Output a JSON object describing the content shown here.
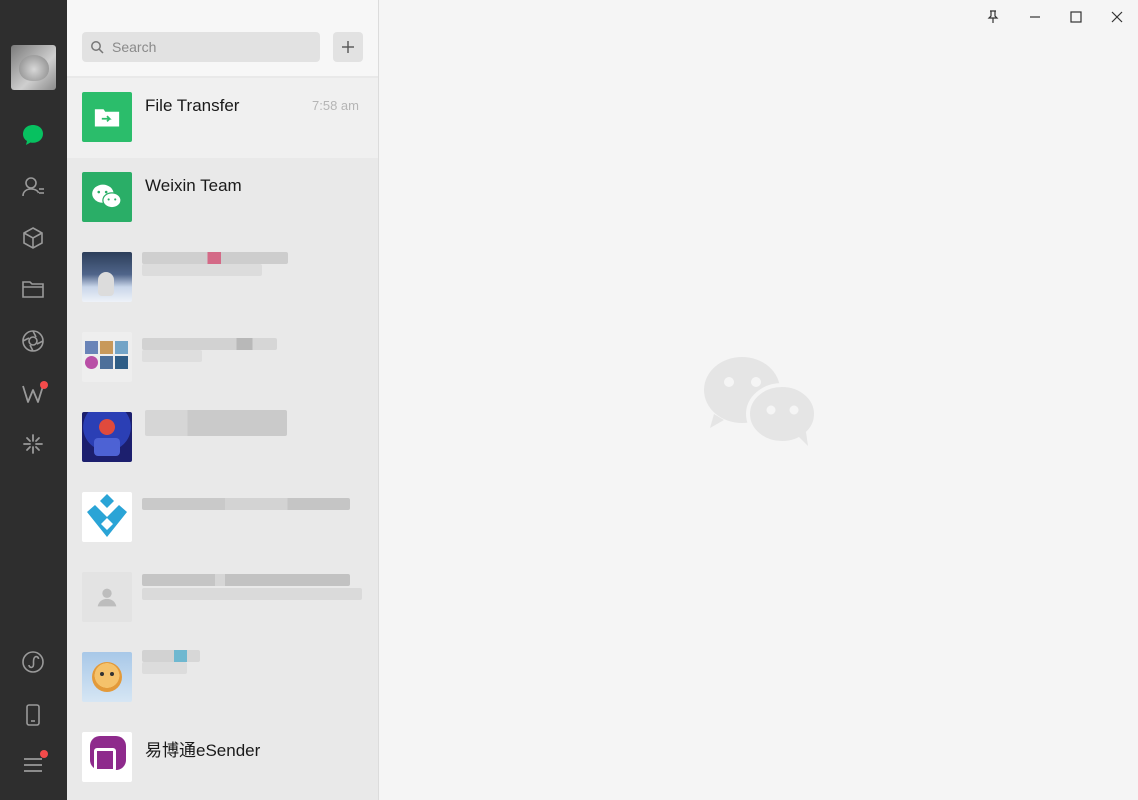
{
  "sidebar": {
    "nav": [
      {
        "id": "chats",
        "icon": "chat-bubble-icon",
        "active": true
      },
      {
        "id": "contacts",
        "icon": "contacts-icon"
      },
      {
        "id": "favorites",
        "icon": "cube-icon"
      },
      {
        "id": "files",
        "icon": "folder-icon"
      },
      {
        "id": "moments",
        "icon": "aperture-icon"
      },
      {
        "id": "channels",
        "icon": "channels-icon",
        "badge": true
      },
      {
        "id": "search",
        "icon": "sparkle-icon"
      }
    ],
    "bottom": [
      {
        "id": "mini-programs",
        "icon": "mini-program-icon"
      },
      {
        "id": "phone",
        "icon": "phone-icon"
      },
      {
        "id": "menu",
        "icon": "menu-icon",
        "badge": true
      }
    ],
    "accent_color": "#07c160"
  },
  "search": {
    "placeholder": "Search"
  },
  "chats": [
    {
      "name": "File Transfer",
      "time": "7:58 am",
      "thumb": "file-transfer"
    },
    {
      "name": "Weixin Team",
      "time": "",
      "thumb": "weixin-team"
    },
    {
      "name": "",
      "time": "",
      "thumb": "snow-photo"
    },
    {
      "name": "",
      "time": "",
      "thumb": "collage"
    },
    {
      "name": "",
      "time": "",
      "thumb": "game-art"
    },
    {
      "name": "",
      "time": "",
      "thumb": "blue-logo"
    },
    {
      "name": "",
      "time": "",
      "thumb": "default-avatar"
    },
    {
      "name": "",
      "time": "",
      "thumb": "tiger"
    },
    {
      "name": "易博通eSender",
      "time": "",
      "thumb": "esender"
    }
  ],
  "window_controls": [
    "pin-icon",
    "minimize-icon",
    "maximize-icon",
    "close-icon"
  ]
}
